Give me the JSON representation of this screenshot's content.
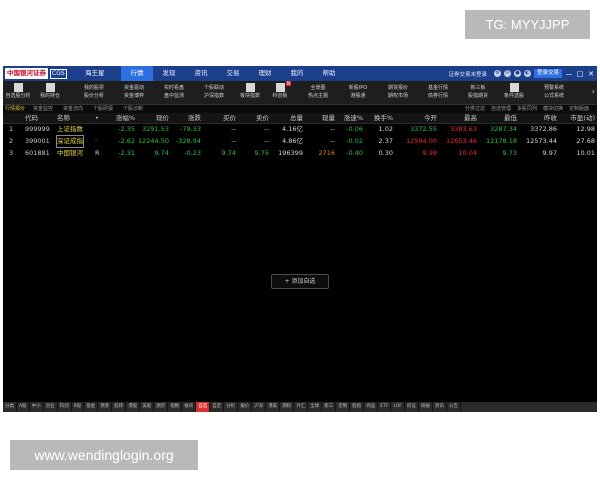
{
  "watermark_top": "TG: MYYJJPP",
  "watermark_bottom": "www.wendinglogin.org",
  "app": {
    "logo_text": "中国银河证券",
    "logo_cgs": "CGS",
    "mode": "海王星",
    "menu": [
      "行情",
      "发现",
      "资讯",
      "交易",
      "理财",
      "我的",
      "帮助"
    ],
    "active_menu": "行情",
    "status_text": "证券交易未登录",
    "login_button": "登录交易",
    "window_controls": [
      "—",
      "□",
      "✕"
    ]
  },
  "toolbar": {
    "big_first": {
      "label": "自选股分析",
      "icon": "star-icon"
    },
    "big_second": {
      "label": "我的持仓",
      "icon": "briefcase-icon"
    },
    "pairs": [
      [
        "我的股票",
        "股价分析"
      ],
      [
        "资金驱动",
        "资金博弈"
      ],
      [
        "实时看盘",
        "盘中监测"
      ],
      [
        "个股联动",
        "沪深指数"
      ]
    ],
    "chart_tool": {
      "label": "板块指数",
      "icon": "chart-line-icon"
    },
    "kcb_tool": {
      "label": "科创板",
      "icon": "kcb-icon",
      "badge": "N"
    },
    "pairs2": [
      [
        "全景图",
        "热点主题"
      ],
      [
        "新股IPO",
        "港股通"
      ],
      [
        "期货报价",
        "期权市场"
      ],
      [
        "基金行情",
        "债券行情"
      ],
      [
        "新三板",
        "股指期货"
      ]
    ],
    "select_tool": {
      "label": "条件选股",
      "icon": "filter-icon"
    },
    "pair_last": [
      "预警系统",
      "公式系统"
    ]
  },
  "subnav": {
    "left": [
      "行情报价",
      "资金监控",
      "资金流向",
      "个股研报",
      "个股诊断"
    ],
    "right": [
      "分类过滤",
      "自选管理",
      "多股同列",
      "模块切换",
      "定制版面"
    ]
  },
  "table": {
    "headers": [
      "代码",
      "名称",
      "•",
      "涨幅%",
      "现价",
      "涨跌",
      "买价",
      "卖价",
      "总量",
      "现量",
      "涨速%",
      "换手%",
      "今开",
      "最高",
      "最低",
      "昨收",
      "市盈(动)"
    ],
    "rows": [
      {
        "idx": "1",
        "code": "999999",
        "name": "上证指数",
        "flag": "",
        "pct": "-2.35",
        "price": "3291.53",
        "chg": "-79.33",
        "bid": "--",
        "ask": "--",
        "vol": "4.16亿",
        "cur": "--",
        "speed": "-0.06",
        "turn": "1.02",
        "open": "3372.55",
        "high": "3383.63",
        "low": "3287.34",
        "prev": "3372.86",
        "pe": "12.98"
      },
      {
        "idx": "2",
        "code": "399001",
        "name": "深证成指",
        "flag": "·",
        "pct": "-2.62",
        "price": "12244.50",
        "chg": "-328.94",
        "bid": "--",
        "ask": "--",
        "vol": "4.86亿",
        "cur": "--",
        "speed": "-0.02",
        "turn": "2.37",
        "open": "12594.00",
        "high": "12653.46",
        "low": "12178.18",
        "prev": "12573.44",
        "pe": "27.68"
      },
      {
        "idx": "3",
        "code": "601881",
        "name": "中国银河",
        "flag": "R",
        "pct": "-2.31",
        "price": "9.74",
        "chg": "-0.23",
        "bid": "9.74",
        "ask": "9.75",
        "vol": "196399",
        "cur": "2716",
        "speed": "-0.40",
        "turn": "0.30",
        "open": "9.99",
        "high": "10.04",
        "low": "9.73",
        "prev": "9.97",
        "pe": "10.01"
      }
    ]
  },
  "add_watchlist": "+ 添加自选",
  "bottom_tabs": [
    "分类",
    "A股",
    "中小",
    "创业",
    "科创",
    "B股",
    "基金",
    "债券",
    "股转",
    "港股",
    "美股",
    "期货",
    "指数",
    "板块",
    "自选",
    "自定",
    "分析",
    "报价",
    "沪深",
    "港美",
    "期权",
    "外汇",
    "全球",
    "新三",
    "定制",
    "股指",
    "商品",
    "ETF",
    "LOF",
    "权证",
    "研报",
    "资讯",
    "公告"
  ],
  "active_bottom_tab": "自选",
  "colors": {
    "up": "#ee2b2b",
    "down": "#27c23f",
    "accent": "#2d6fe0",
    "title": "#1c3f8c"
  }
}
